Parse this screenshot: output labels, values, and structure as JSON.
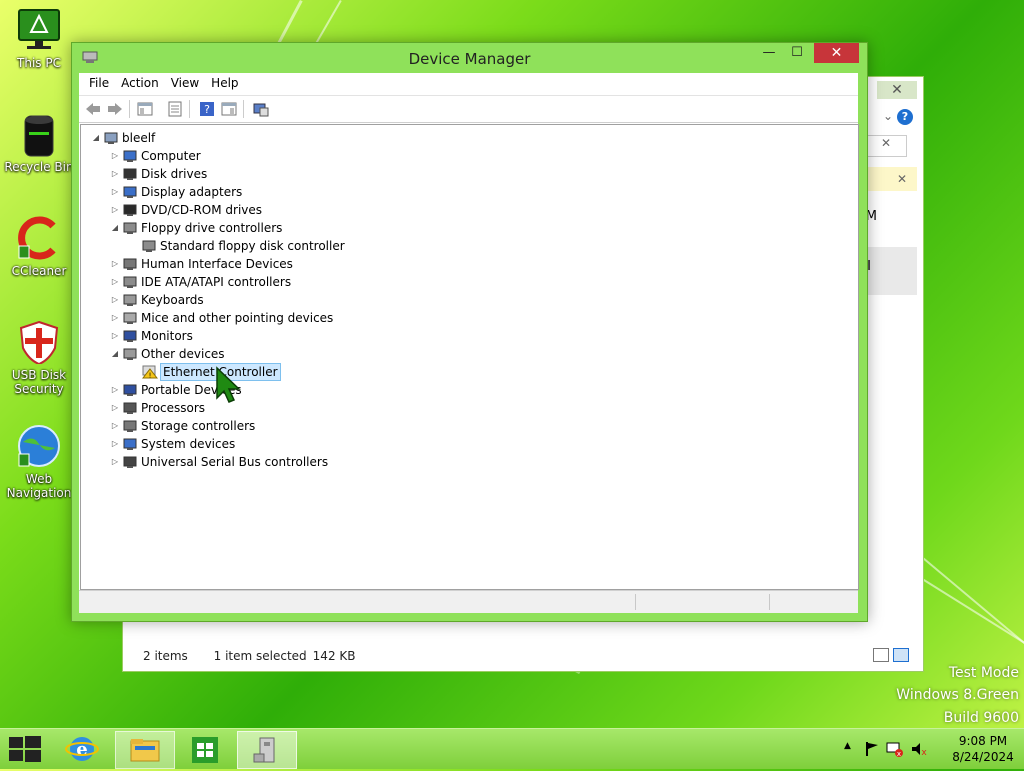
{
  "desktop": {
    "icons": [
      {
        "label": "This PC",
        "icon": "monitor-icon"
      },
      {
        "label": "Recycle Bin",
        "icon": "recycle-bin-icon"
      },
      {
        "label": "CCleaner",
        "icon": "ccleaner-icon"
      },
      {
        "label": "USB Disk Security",
        "icon": "shield-icon"
      },
      {
        "label": "Web Navigation",
        "icon": "globe-icon"
      }
    ],
    "watermark": [
      "Test Mode",
      "Windows 8.Green",
      "Build 9600"
    ]
  },
  "background_window": {
    "close_glyph": "✕",
    "status": {
      "items": "2 items",
      "selected": "1 item selected",
      "size": "142 KB"
    },
    "partial_text": [
      "M",
      "I"
    ]
  },
  "device_manager": {
    "title": "Device Manager",
    "caption": {
      "minimize": "—",
      "maximize": "☐",
      "close": "✕"
    },
    "menu": [
      "File",
      "Action",
      "View",
      "Help"
    ],
    "tree": [
      {
        "label": "bleelf",
        "icon": "computer-root-icon",
        "state": "expanded",
        "level": 0
      },
      {
        "label": "Computer",
        "icon": "computer-icon",
        "state": "collapsed",
        "level": 1
      },
      {
        "label": "Disk drives",
        "icon": "disk-drive-icon",
        "state": "collapsed",
        "level": 1
      },
      {
        "label": "Display adapters",
        "icon": "display-adapter-icon",
        "state": "collapsed",
        "level": 1
      },
      {
        "label": "DVD/CD-ROM drives",
        "icon": "dvd-icon",
        "state": "collapsed",
        "level": 1
      },
      {
        "label": "Floppy drive controllers",
        "icon": "floppy-controller-icon",
        "state": "expanded",
        "level": 1
      },
      {
        "label": "Standard floppy disk controller",
        "icon": "floppy-controller-icon",
        "state": "leaf",
        "level": 2
      },
      {
        "label": "Human Interface Devices",
        "icon": "hid-icon",
        "state": "collapsed",
        "level": 1
      },
      {
        "label": "IDE ATA/ATAPI controllers",
        "icon": "ide-icon",
        "state": "collapsed",
        "level": 1
      },
      {
        "label": "Keyboards",
        "icon": "keyboard-icon",
        "state": "collapsed",
        "level": 1
      },
      {
        "label": "Mice and other pointing devices",
        "icon": "mouse-icon",
        "state": "collapsed",
        "level": 1
      },
      {
        "label": "Monitors",
        "icon": "monitor-icon",
        "state": "collapsed",
        "level": 1
      },
      {
        "label": "Other devices",
        "icon": "other-devices-icon",
        "state": "expanded",
        "level": 1
      },
      {
        "label": "Ethernet Controller",
        "icon": "warning-device-icon",
        "state": "leaf",
        "level": 2,
        "selected": true
      },
      {
        "label": "Portable Devices",
        "icon": "portable-device-icon",
        "state": "collapsed",
        "level": 1
      },
      {
        "label": "Processors",
        "icon": "processor-icon",
        "state": "collapsed",
        "level": 1
      },
      {
        "label": "Storage controllers",
        "icon": "storage-controller-icon",
        "state": "collapsed",
        "level": 1
      },
      {
        "label": "System devices",
        "icon": "system-devices-icon",
        "state": "collapsed",
        "level": 1
      },
      {
        "label": "Universal Serial Bus controllers",
        "icon": "usb-icon",
        "state": "collapsed",
        "level": 1
      }
    ]
  },
  "taskbar": {
    "apps": [
      "start-icon",
      "internet-explorer-icon",
      "file-explorer-icon",
      "store-icon",
      "device-manager-icon"
    ],
    "time": "9:08 PM",
    "date": "8/24/2024"
  },
  "colors": {
    "accent": "#8fe15a",
    "close": "#c7353a",
    "selection": "#cde8ff",
    "warning": "#f5c518"
  }
}
